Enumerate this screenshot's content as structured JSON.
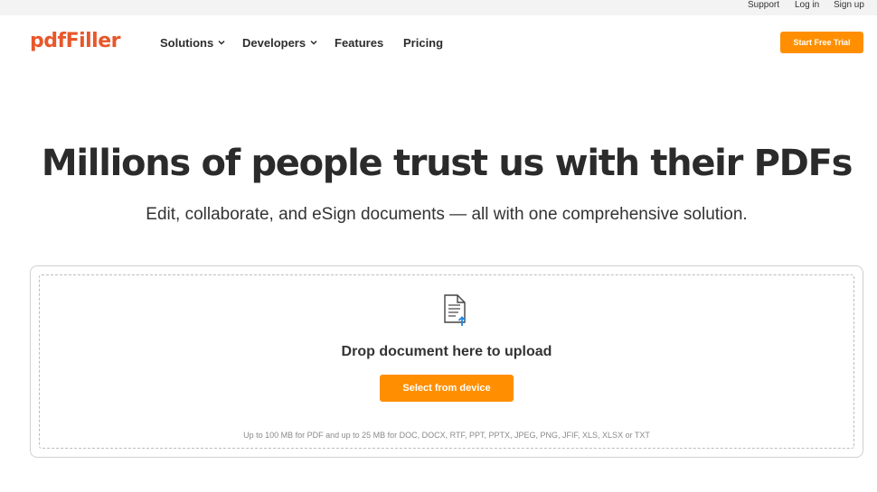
{
  "topbar": {
    "support": "Support",
    "login": "Log in",
    "signup": "Sign up"
  },
  "header": {
    "logo": "pdfFiller",
    "nav": {
      "solutions": "Solutions",
      "developers": "Developers",
      "features": "Features",
      "pricing": "Pricing"
    },
    "cta": "Start Free Trial"
  },
  "hero": {
    "title": "Millions of people trust us with their PDFs",
    "subtitle": "Edit, collaborate, and eSign documents — all with one comprehensive solution."
  },
  "upload": {
    "icon": "document-upload-icon",
    "drop_label": "Drop document here to upload",
    "button": "Select from device",
    "limits": "Up to 100 MB for PDF and up to 25 MB for DOC, DOCX, RTF, PPT, PPTX, JPEG, PNG, JFIF, XLS, XLSX or TXT"
  },
  "colors": {
    "brand": "#e8572a",
    "accent": "#ff8f00",
    "upload_arrow": "#1e88e5"
  }
}
